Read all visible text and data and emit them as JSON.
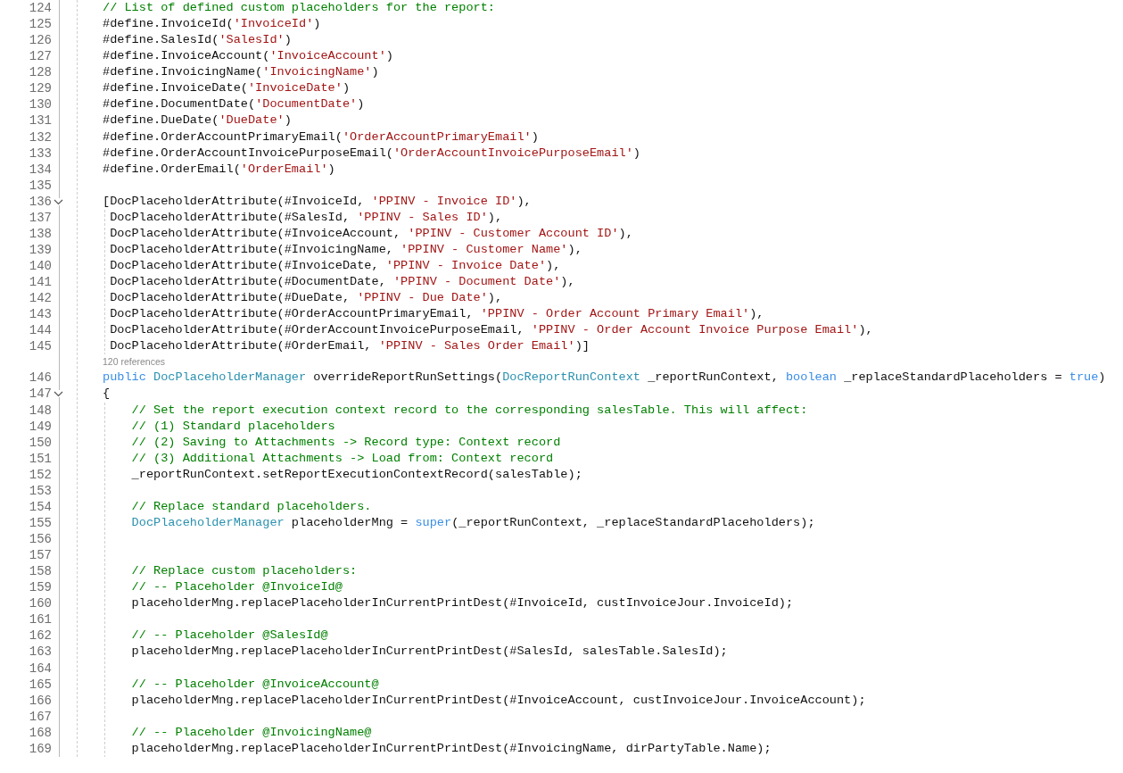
{
  "editor": {
    "lines": [
      {
        "number": "124",
        "tokens": [
          {
            "kind": "comment",
            "text": "// List of defined custom placeholders for the report:"
          }
        ]
      },
      {
        "number": "125",
        "tokens": [
          {
            "kind": "plain",
            "text": "#define.InvoiceId("
          },
          {
            "kind": "string",
            "text": "'InvoiceId'"
          },
          {
            "kind": "plain",
            "text": ")"
          }
        ]
      },
      {
        "number": "126",
        "tokens": [
          {
            "kind": "plain",
            "text": "#define.SalesId("
          },
          {
            "kind": "string",
            "text": "'SalesId'"
          },
          {
            "kind": "plain",
            "text": ")"
          }
        ]
      },
      {
        "number": "127",
        "tokens": [
          {
            "kind": "plain",
            "text": "#define.InvoiceAccount("
          },
          {
            "kind": "string",
            "text": "'InvoiceAccount'"
          },
          {
            "kind": "plain",
            "text": ")"
          }
        ]
      },
      {
        "number": "128",
        "tokens": [
          {
            "kind": "plain",
            "text": "#define.InvoicingName("
          },
          {
            "kind": "string",
            "text": "'InvoicingName'"
          },
          {
            "kind": "plain",
            "text": ")"
          }
        ]
      },
      {
        "number": "129",
        "tokens": [
          {
            "kind": "plain",
            "text": "#define.InvoiceDate("
          },
          {
            "kind": "string",
            "text": "'InvoiceDate'"
          },
          {
            "kind": "plain",
            "text": ")"
          }
        ]
      },
      {
        "number": "130",
        "tokens": [
          {
            "kind": "plain",
            "text": "#define.DocumentDate("
          },
          {
            "kind": "string",
            "text": "'DocumentDate'"
          },
          {
            "kind": "plain",
            "text": ")"
          }
        ]
      },
      {
        "number": "131",
        "tokens": [
          {
            "kind": "plain",
            "text": "#define.DueDate("
          },
          {
            "kind": "string",
            "text": "'DueDate'"
          },
          {
            "kind": "plain",
            "text": ")"
          }
        ]
      },
      {
        "number": "132",
        "tokens": [
          {
            "kind": "plain",
            "text": "#define.OrderAccountPrimaryEmail("
          },
          {
            "kind": "string",
            "text": "'OrderAccountPrimaryEmail'"
          },
          {
            "kind": "plain",
            "text": ")"
          }
        ]
      },
      {
        "number": "133",
        "tokens": [
          {
            "kind": "plain",
            "text": "#define.OrderAccountInvoicePurposeEmail("
          },
          {
            "kind": "string",
            "text": "'OrderAccountInvoicePurposeEmail'"
          },
          {
            "kind": "plain",
            "text": ")"
          }
        ]
      },
      {
        "number": "134",
        "tokens": [
          {
            "kind": "plain",
            "text": "#define.OrderEmail("
          },
          {
            "kind": "string",
            "text": "'OrderEmail'"
          },
          {
            "kind": "plain",
            "text": ")"
          }
        ]
      },
      {
        "number": "135"
      },
      {
        "number": "136",
        "expanded": true,
        "tokens": [
          {
            "kind": "plain",
            "text": "[DocPlaceholderAttribute(#InvoiceId, "
          },
          {
            "kind": "string",
            "text": "'PPINV - Invoice ID'"
          },
          {
            "kind": "plain",
            "text": "),"
          }
        ],
        "children": [
          {
            "number": "137",
            "tokens": [
              {
                "kind": "plain",
                "text": " DocPlaceholderAttribute(#SalesId, "
              },
              {
                "kind": "string",
                "text": "'PPINV - Sales ID'"
              },
              {
                "kind": "plain",
                "text": "),"
              }
            ]
          },
          {
            "number": "138",
            "tokens": [
              {
                "kind": "plain",
                "text": " DocPlaceholderAttribute(#InvoiceAccount, "
              },
              {
                "kind": "string",
                "text": "'PPINV - Customer Account ID'"
              },
              {
                "kind": "plain",
                "text": "),"
              }
            ]
          },
          {
            "number": "139",
            "tokens": [
              {
                "kind": "plain",
                "text": " DocPlaceholderAttribute(#InvoicingName, "
              },
              {
                "kind": "string",
                "text": "'PPINV - Customer Name'"
              },
              {
                "kind": "plain",
                "text": "),"
              }
            ]
          },
          {
            "number": "140",
            "tokens": [
              {
                "kind": "plain",
                "text": " DocPlaceholderAttribute(#InvoiceDate, "
              },
              {
                "kind": "string",
                "text": "'PPINV - Invoice Date'"
              },
              {
                "kind": "plain",
                "text": "),"
              }
            ]
          },
          {
            "number": "141",
            "tokens": [
              {
                "kind": "plain",
                "text": " DocPlaceholderAttribute(#DocumentDate, "
              },
              {
                "kind": "string",
                "text": "'PPINV - Document Date'"
              },
              {
                "kind": "plain",
                "text": "),"
              }
            ]
          },
          {
            "number": "142",
            "tokens": [
              {
                "kind": "plain",
                "text": " DocPlaceholderAttribute(#DueDate, "
              },
              {
                "kind": "string",
                "text": "'PPINV - Due Date'"
              },
              {
                "kind": "plain",
                "text": "),"
              }
            ]
          },
          {
            "number": "143",
            "tokens": [
              {
                "kind": "plain",
                "text": " DocPlaceholderAttribute(#OrderAccountPrimaryEmail, "
              },
              {
                "kind": "string",
                "text": "'PPINV - Order Account Primary Email'"
              },
              {
                "kind": "plain",
                "text": "),"
              }
            ]
          },
          {
            "number": "144",
            "tokens": [
              {
                "kind": "plain",
                "text": " DocPlaceholderAttribute(#OrderAccountInvoicePurposeEmail, "
              },
              {
                "kind": "string",
                "text": "'PPINV - Order Account Invoice Purpose Email'"
              },
              {
                "kind": "plain",
                "text": "),"
              }
            ]
          },
          {
            "number": "145",
            "tokens": [
              {
                "kind": "plain",
                "text": " DocPlaceholderAttribute(#OrderEmail, "
              },
              {
                "kind": "string",
                "text": "'PPINV - Sales Order Email'"
              },
              {
                "kind": "plain",
                "text": ")]"
              }
            ]
          }
        ]
      },
      {
        "number": "146",
        "references": "120 references",
        "tokens": [
          {
            "kind": "keyword",
            "text": "public"
          },
          {
            "kind": "type",
            "text": " DocPlaceholderManager"
          },
          {
            "kind": "plain",
            "text": " overrideReportRunSettings("
          },
          {
            "kind": "type",
            "text": "DocReportRunContext"
          },
          {
            "kind": "plain",
            "text": " _reportRunContext, "
          },
          {
            "kind": "keyword",
            "text": "boolean"
          },
          {
            "kind": "plain",
            "text": " _replaceStandardPlaceholders = "
          },
          {
            "kind": "keyword",
            "text": "true"
          },
          {
            "kind": "plain",
            "text": ")"
          }
        ]
      },
      {
        "number": "147",
        "expanded": true,
        "tokens": [
          {
            "kind": "plain",
            "text": "{"
          }
        ],
        "children": [
          {
            "number": "148",
            "tokens": [
              {
                "kind": "comment",
                "text": "    // Set the report execution context record to the corresponding salesTable. This will affect:"
              }
            ]
          },
          {
            "number": "149",
            "tokens": [
              {
                "kind": "comment",
                "text": "    // (1) Standard placeholders"
              }
            ]
          },
          {
            "number": "150",
            "tokens": [
              {
                "kind": "comment",
                "text": "    // (2) Saving to Attachments -> Record type: Context record"
              }
            ]
          },
          {
            "number": "151",
            "tokens": [
              {
                "kind": "comment",
                "text": "    // (3) Additional Attachments -> Load from: Context record"
              }
            ]
          },
          {
            "number": "152",
            "tokens": [
              {
                "kind": "plain",
                "text": "    _reportRunContext.setReportExecutionContextRecord(salesTable);"
              }
            ]
          },
          {
            "number": "153"
          },
          {
            "number": "154",
            "tokens": [
              {
                "kind": "comment",
                "text": "    // Replace standard placeholders."
              }
            ]
          },
          {
            "number": "155",
            "tokens": [
              {
                "kind": "type",
                "text": "    DocPlaceholderManager"
              },
              {
                "kind": "plain",
                "text": " placeholderMng = "
              },
              {
                "kind": "keyword",
                "text": "super"
              },
              {
                "kind": "plain",
                "text": "(_reportRunContext, _replaceStandardPlaceholders);"
              }
            ]
          },
          {
            "number": "156"
          },
          {
            "number": "157"
          },
          {
            "number": "158",
            "tokens": [
              {
                "kind": "comment",
                "text": "    // Replace custom placeholders:"
              }
            ]
          },
          {
            "number": "159",
            "tokens": [
              {
                "kind": "comment",
                "text": "    // -- Placeholder @InvoiceId@"
              }
            ]
          },
          {
            "number": "160",
            "tokens": [
              {
                "kind": "plain",
                "text": "    placeholderMng.replacePlaceholderInCurrentPrintDest(#InvoiceId, custInvoiceJour.InvoiceId);"
              }
            ]
          },
          {
            "number": "161"
          },
          {
            "number": "162",
            "tokens": [
              {
                "kind": "comment",
                "text": "    // -- Placeholder @SalesId@"
              }
            ]
          },
          {
            "number": "163",
            "tokens": [
              {
                "kind": "plain",
                "text": "    placeholderMng.replacePlaceholderInCurrentPrintDest(#SalesId, salesTable.SalesId);"
              }
            ]
          },
          {
            "number": "164"
          },
          {
            "number": "165",
            "tokens": [
              {
                "kind": "comment",
                "text": "    // -- Placeholder @InvoiceAccount@"
              }
            ]
          },
          {
            "number": "166",
            "tokens": [
              {
                "kind": "plain",
                "text": "    placeholderMng.replacePlaceholderInCurrentPrintDest(#InvoiceAccount, custInvoiceJour.InvoiceAccount);"
              }
            ]
          },
          {
            "number": "167"
          },
          {
            "number": "168",
            "tokens": [
              {
                "kind": "comment",
                "text": "    // -- Placeholder @InvoicingName@"
              }
            ]
          },
          {
            "number": "169",
            "tokens": [
              {
                "kind": "plain",
                "text": "    placeholderMng.replacePlaceholderInCurrentPrintDest(#InvoicingName, dirPartyTable.Name);"
              }
            ]
          }
        ]
      }
    ]
  }
}
